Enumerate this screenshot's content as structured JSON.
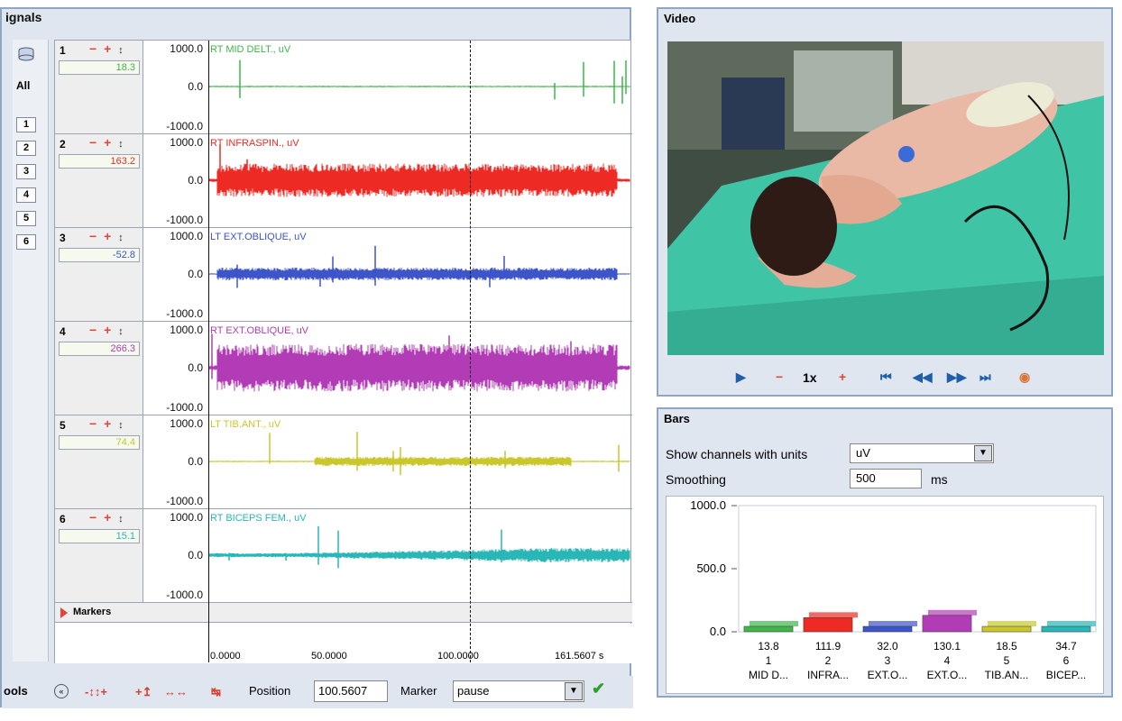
{
  "signals_panel": {
    "title": "ignals",
    "all_label": "All",
    "channel_buttons": [
      "1",
      "2",
      "3",
      "4",
      "5",
      "6"
    ],
    "channels": [
      {
        "num": "1",
        "value": "18.3",
        "name": "RT MID DELT., uV",
        "color": "#3fb54a",
        "ymax": "1000.0",
        "ymid": "0.0",
        "ymin": "-1000.0",
        "amp": 0.06,
        "pattern": "spike"
      },
      {
        "num": "2",
        "value": "163.2",
        "name": "RT INFRASPIN., uV",
        "color": "#ee2a24",
        "ymax": "1000.0",
        "ymid": "0.0",
        "ymin": "-1000.0",
        "amp": 0.42,
        "pattern": "burst"
      },
      {
        "num": "3",
        "value": "-52.8",
        "name": "LT EXT.OBLIQUE, uV",
        "color": "#3d55c8",
        "ymax": "1000.0",
        "ymid": "0.0",
        "ymin": "-1000.0",
        "amp": 0.16,
        "pattern": "burst"
      },
      {
        "num": "4",
        "value": "266.3",
        "name": "RT EXT.OBLIQUE, uV",
        "color": "#b23cb5",
        "ymax": "1000.0",
        "ymid": "0.0",
        "ymin": "-1000.0",
        "amp": 0.6,
        "pattern": "burst"
      },
      {
        "num": "5",
        "value": "74.4",
        "name": "LT TIB.ANT., uV",
        "color": "#c9c72c",
        "ymax": "1000.0",
        "ymid": "0.0",
        "ymin": "-1000.0",
        "amp": 0.12,
        "pattern": "mid"
      },
      {
        "num": "6",
        "value": "15.1",
        "name": "RT BICEPS FEM., uV",
        "color": "#29b6b6",
        "ymax": "1000.0",
        "ymid": "0.0",
        "ymin": "-1000.0",
        "amp": 0.18,
        "pattern": "rise"
      }
    ],
    "markers_label": "Markers",
    "time_ticks": [
      "0.0000",
      "50.0000",
      "100.0000",
      "161.5607 s"
    ],
    "cursor_time": 100.5607,
    "time_max": 161.5607
  },
  "tools": {
    "label": "ools",
    "position_label": "Position",
    "position_value": "100.5607",
    "marker_label": "Marker",
    "marker_value": "pause"
  },
  "video_panel": {
    "title": "Video",
    "speed": "1x"
  },
  "bars_panel": {
    "title": "Bars",
    "show_label": "Show channels with units",
    "units_value": "uV",
    "smoothing_label": "Smoothing",
    "smoothing_value": "500",
    "ms_label": "ms"
  },
  "chart_data": {
    "type": "bar",
    "categories": [
      "1\nMID D...",
      "2\nINFRA...",
      "3\nEXT.O...",
      "4\nEXT.O...",
      "5\nTIB.AN...",
      "6\nBICEP..."
    ],
    "category_nums": [
      "1",
      "2",
      "3",
      "4",
      "5",
      "6"
    ],
    "category_names": [
      "MID D...",
      "INFRA...",
      "EXT.O...",
      "EXT.O...",
      "TIB.AN...",
      "BICEP..."
    ],
    "values": [
      13.8,
      111.9,
      32.0,
      130.1,
      18.5,
      34.7
    ],
    "value_labels": [
      "13.8",
      "111.9",
      "32.0",
      "130.1",
      "18.5",
      "34.7"
    ],
    "colors": [
      "#3fb54a",
      "#ee2a24",
      "#3d55c8",
      "#b23cb5",
      "#c9c72c",
      "#29b6b6"
    ],
    "yticks": [
      "1000.0",
      "500.0",
      "0.0"
    ],
    "ylim": [
      0,
      1000
    ],
    "title": "",
    "xlabel": "",
    "ylabel": ""
  }
}
